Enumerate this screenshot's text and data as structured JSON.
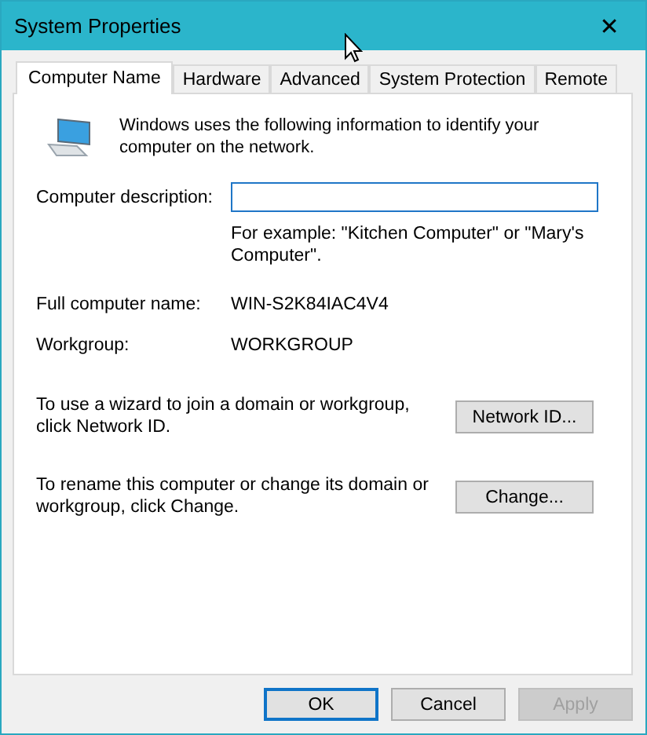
{
  "window": {
    "title": "System Properties",
    "close": "✕"
  },
  "tabs": [
    {
      "label": "Computer Name",
      "selected": true
    },
    {
      "label": "Hardware",
      "selected": false
    },
    {
      "label": "Advanced",
      "selected": false
    },
    {
      "label": "System Protection",
      "selected": false
    },
    {
      "label": "Remote",
      "selected": false
    }
  ],
  "intro": "Windows uses the following information to identify your computer on the network.",
  "description": {
    "label": "Computer description:",
    "hint": "For example: \"Kitchen Computer\" or \"Mary's Computer\"."
  },
  "info": [
    {
      "label": "Full computer name:",
      "value": "WIN-S2K84IAC4V4"
    },
    {
      "label": "Workgroup:",
      "value": "WORKGROUP"
    }
  ],
  "actions": [
    {
      "text": "To use a wizard to join a domain or workgroup, click Network ID.",
      "button": "Network ID..."
    },
    {
      "text": "To rename this computer or change its domain or workgroup, click Change.",
      "button": "Change..."
    }
  ],
  "buttons": [
    {
      "label": "OK",
      "default": true,
      "disabled": false
    },
    {
      "label": "Cancel",
      "default": false,
      "disabled": false
    },
    {
      "label": "Apply",
      "default": false,
      "disabled": true
    }
  ]
}
